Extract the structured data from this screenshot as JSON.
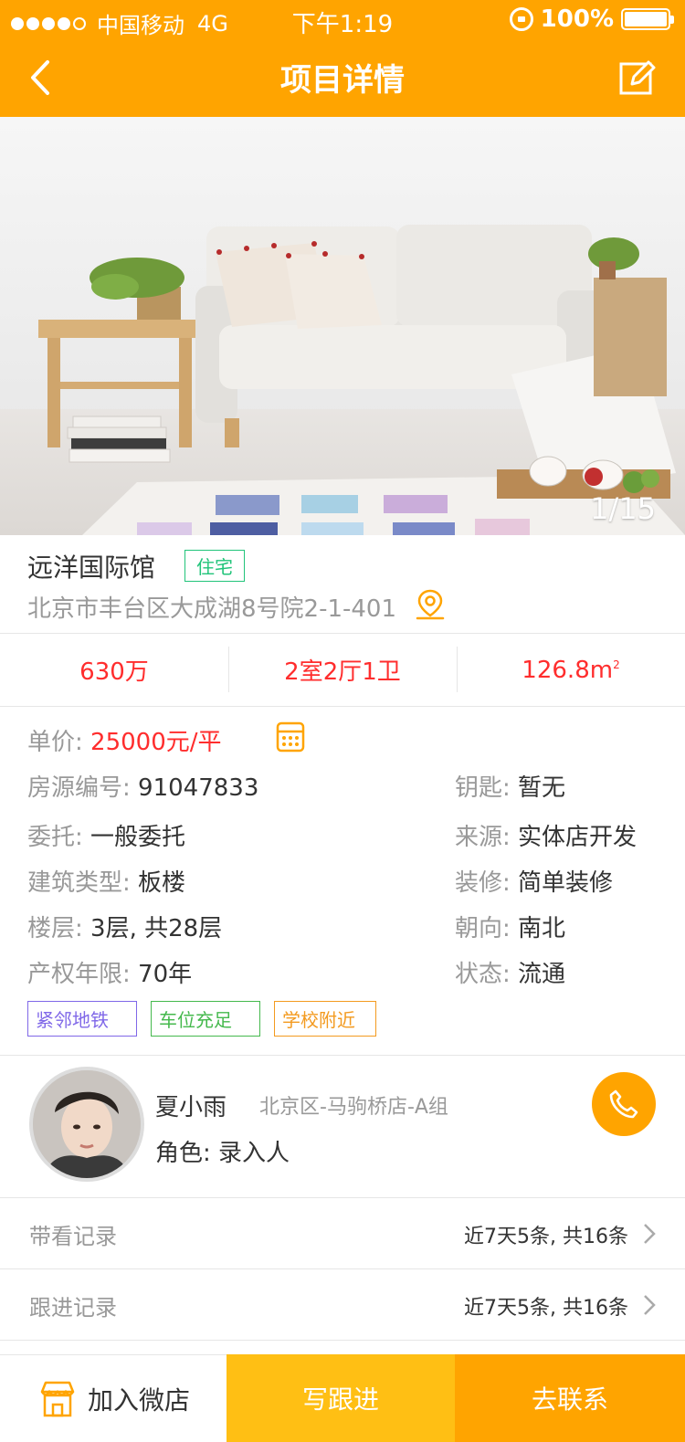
{
  "status": {
    "carrier": "中国移动",
    "network": "4G",
    "time": "下午1:19",
    "battery": "100%"
  },
  "nav": {
    "title": "项目详情"
  },
  "gallery": {
    "counter": "1/15"
  },
  "project": {
    "name": "远洋国际馆",
    "type_tag": "住宅",
    "address": "北京市丰台区大成湖8号院2-1-401"
  },
  "stats": {
    "price": "630万",
    "layout": "2室2厅1卫",
    "area": "126.8m",
    "area_unit_sup": "2"
  },
  "details": {
    "unit_price_label": "单价:",
    "unit_price_value": "25000元/平",
    "left": [
      {
        "label": "房源编号:",
        "value": "91047833"
      },
      {
        "label": "委托:",
        "value": "一般委托"
      },
      {
        "label": "建筑类型:",
        "value": "板楼"
      },
      {
        "label": "楼层:",
        "value": "3层, 共28层"
      },
      {
        "label": "产权年限:",
        "value": "70年"
      }
    ],
    "right": [
      {
        "label": "钥匙:",
        "value": "暂无"
      },
      {
        "label": "来源:",
        "value": "实体店开发"
      },
      {
        "label": "装修:",
        "value": "简单装修"
      },
      {
        "label": "朝向:",
        "value": "南北"
      },
      {
        "label": "状态:",
        "value": "流通"
      }
    ],
    "tags": [
      "紧邻地铁",
      "车位充足",
      "学校附近"
    ]
  },
  "agent": {
    "name": "夏小雨",
    "store": "北京区-马驹桥店-A组",
    "role": "角色: 录入人"
  },
  "records": [
    {
      "label": "带看记录",
      "summary": "近7天5条, 共16条"
    },
    {
      "label": "跟进记录",
      "summary": "近7天5条, 共16条"
    }
  ],
  "bottom": {
    "shop_label": "加入微店",
    "follow_label": "写跟进",
    "contact_label": "去联系"
  },
  "colors": {
    "brand": "#FFA400",
    "follow_btn": "#FFBF14",
    "price_red": "#FF2D2D",
    "tag_green": "#21C47A"
  }
}
